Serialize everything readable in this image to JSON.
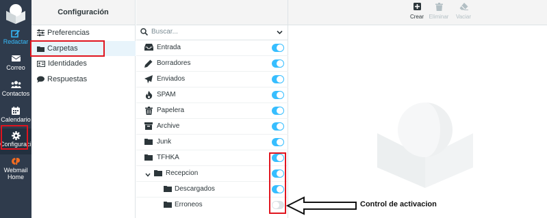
{
  "nav": {
    "items": [
      {
        "label": "Redactar",
        "icon": "compose-icon"
      },
      {
        "label": "Correo",
        "icon": "envelope-icon"
      },
      {
        "label": "Contactos",
        "icon": "contacts-icon"
      },
      {
        "label": "Calendario",
        "icon": "calendar-icon"
      },
      {
        "label": "Configuraci…",
        "icon": "gear-icon"
      },
      {
        "label": "Webmail Home",
        "icon": "cpanel-icon"
      }
    ]
  },
  "settings": {
    "title": "Configuración",
    "items": [
      {
        "label": "Preferencias",
        "icon": "sliders-icon"
      },
      {
        "label": "Carpetas",
        "icon": "folder-icon"
      },
      {
        "label": "Identidades",
        "icon": "id-card-icon"
      },
      {
        "label": "Respuestas",
        "icon": "comment-icon"
      }
    ]
  },
  "folders": {
    "search_placeholder": "Buscar...",
    "rows": [
      {
        "label": "Entrada",
        "icon": "inbox-icon",
        "enabled": true
      },
      {
        "label": "Borradores",
        "icon": "pencil-icon",
        "enabled": true
      },
      {
        "label": "Enviados",
        "icon": "paper-plane-icon",
        "enabled": true
      },
      {
        "label": "SPAM",
        "icon": "fire-icon",
        "enabled": true
      },
      {
        "label": "Papelera",
        "icon": "trash-icon",
        "enabled": true
      },
      {
        "label": "Archive",
        "icon": "archive-icon",
        "enabled": true
      },
      {
        "label": "Junk",
        "icon": "folder-icon",
        "enabled": true
      },
      {
        "label": "TFHKA",
        "icon": "folder-icon",
        "enabled": true
      },
      {
        "label": "Recepcion",
        "icon": "folder-icon",
        "enabled": true
      },
      {
        "label": "Descargados",
        "icon": "folder-icon",
        "enabled": true
      },
      {
        "label": "Erroneos",
        "icon": "folder-icon",
        "enabled": false
      }
    ]
  },
  "toolbar": {
    "create_label": "Crear",
    "delete_label": "Eliminar",
    "empty_label": "Vaciar"
  },
  "annotation": {
    "text": "Control de activacion"
  },
  "colors": {
    "nav_bg": "#2f3b4c",
    "accent": "#37beff",
    "highlight": "#e0141e"
  }
}
